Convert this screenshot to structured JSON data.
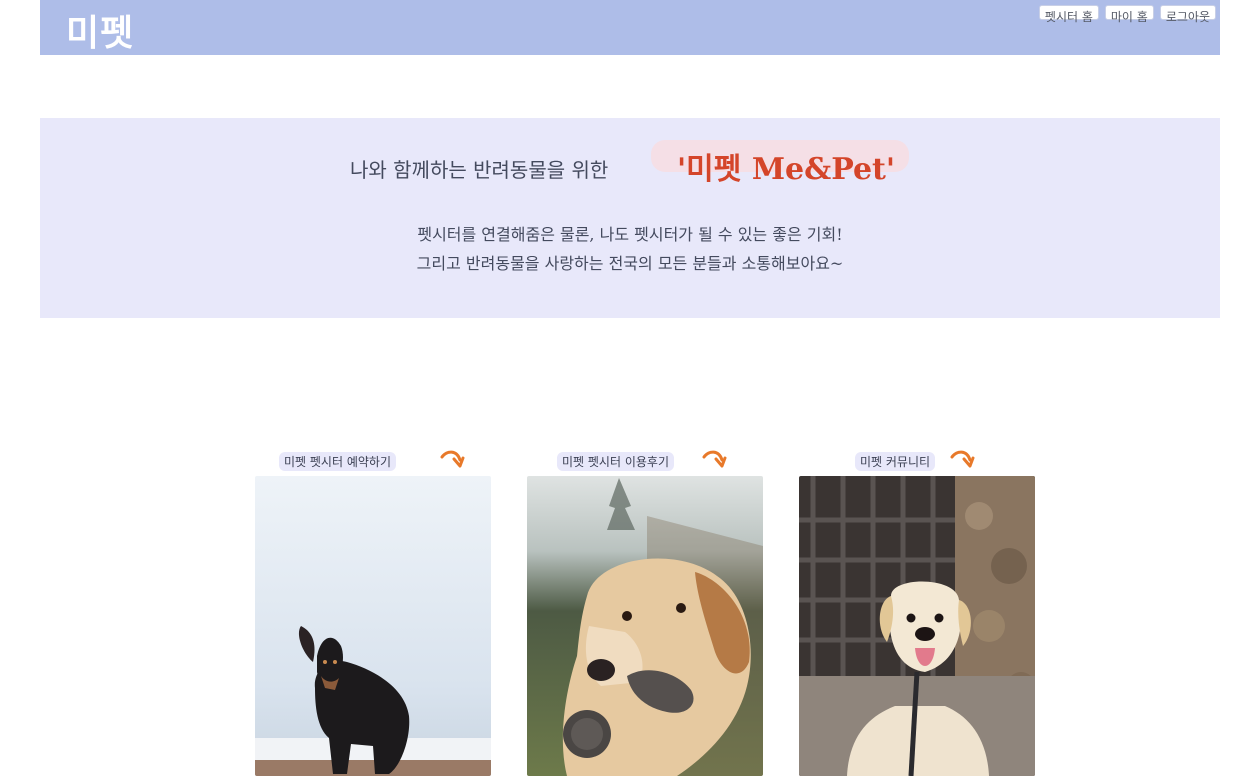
{
  "header": {
    "logo": "미펫",
    "nav": [
      "펫시터 홈",
      "마이 홈",
      "로그아웃"
    ]
  },
  "hero": {
    "line1": "나와 함께하는 반려동물을 위한",
    "brand": "'미펫 Me&Pet'",
    "line2": "펫시터를 연결해줌은 물론, 나도 펫시터가 될 수 있는 좋은 기회!",
    "line3": "그리고 반려동물을 사랑하는 전국의 모든 분들과 소통해보아요~"
  },
  "cards": [
    {
      "label": "미펫 펫시터 예약하기",
      "icon": "curved-arrow-icon",
      "image": "dachshund-dog-photo"
    },
    {
      "label": "미펫 펫시터 이용후기",
      "icon": "curved-arrow-icon",
      "image": "golden-retriever-photo"
    },
    {
      "label": "미펫 커뮤니티",
      "icon": "curved-arrow-icon",
      "image": "puppy-photo"
    }
  ],
  "colors": {
    "header_bg": "#aebde8",
    "hero_bg": "#e8e8fa",
    "brand": "#d4452a",
    "arrow": "#e8792a"
  }
}
